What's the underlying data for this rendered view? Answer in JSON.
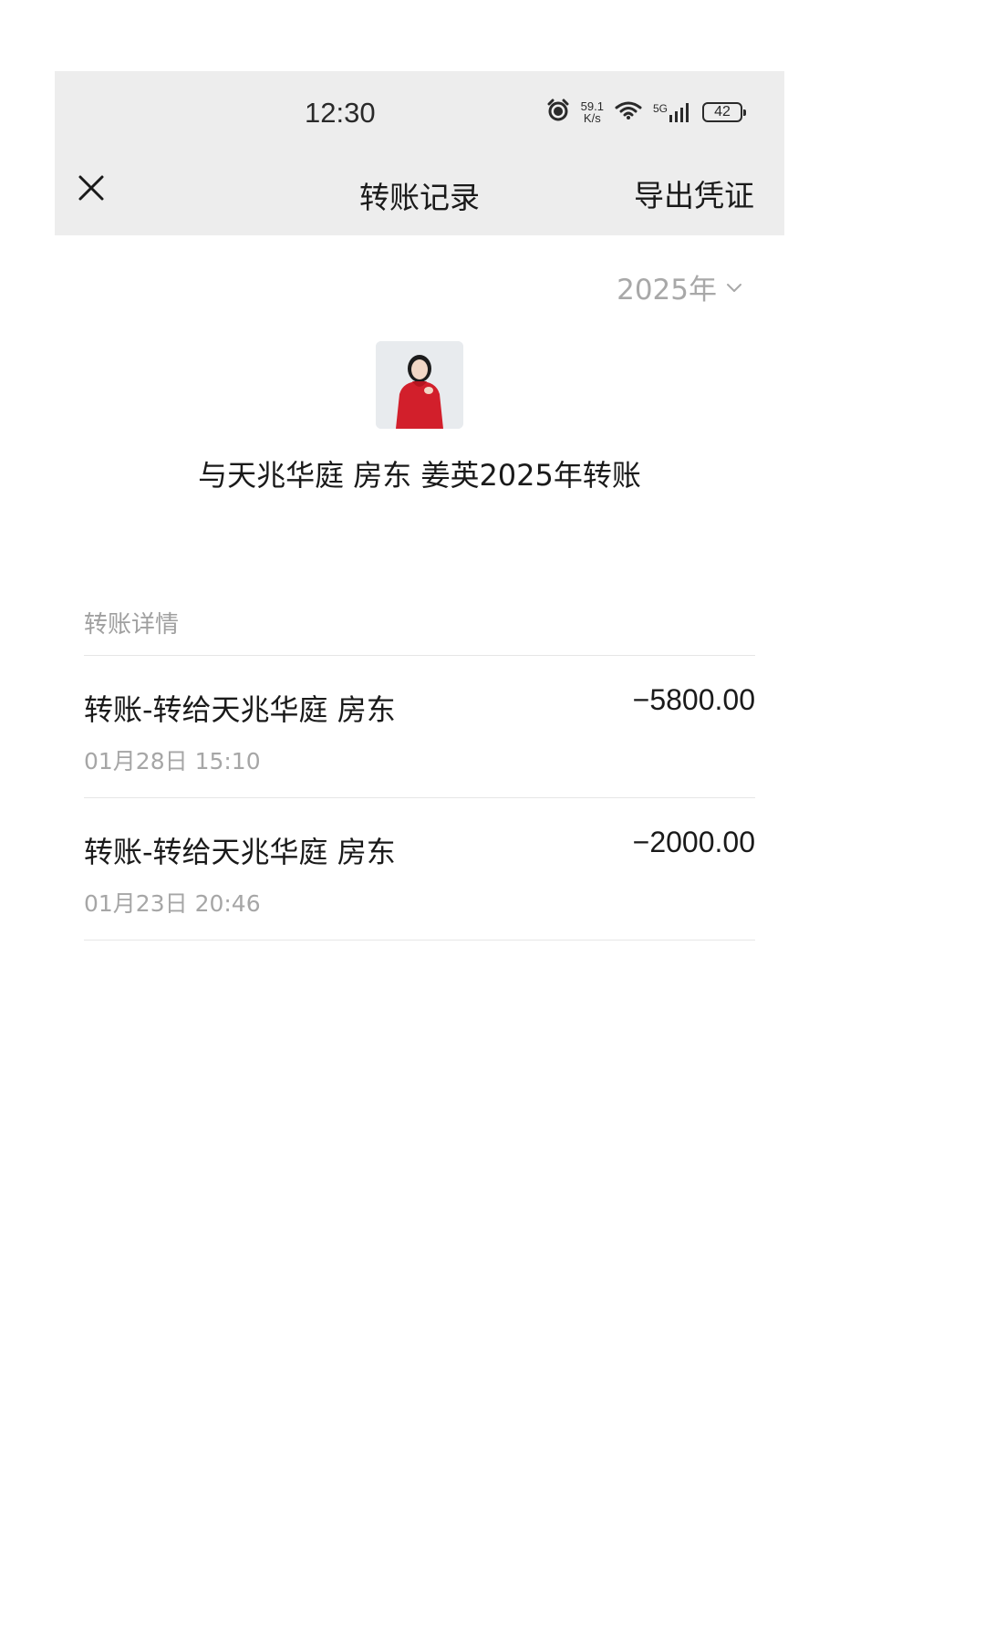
{
  "status_bar": {
    "time": "12:30",
    "net_speed_value": "59.1",
    "net_speed_unit": "K/s",
    "network_type": "5G",
    "battery": "42",
    "icons": [
      "alarm-icon",
      "wifi-icon",
      "signal-icon",
      "battery-icon"
    ]
  },
  "nav": {
    "close_icon": "close-icon",
    "title": "转账记录",
    "export_label": "导出凭证"
  },
  "filter": {
    "year_label": "2025年",
    "chevron_icon": "chevron-down-icon"
  },
  "contact": {
    "avatar_desc": "avatar",
    "summary_title": "与天兆华庭 房东 姜英2025年转账"
  },
  "details": {
    "section_label": "转账详情",
    "transactions": [
      {
        "title": "转账-转给天兆华庭 房东",
        "time": "01月28日 15:10",
        "amount": "−5800.00"
      },
      {
        "title": "转账-转给天兆华庭 房东",
        "time": "01月23日 20:46",
        "amount": "−2000.00"
      }
    ]
  },
  "colors": {
    "header_bg": "#ededed",
    "primary_text": "#1a1a1a",
    "secondary_text": "#a6a6a6",
    "avatar_accent": "#d21f2b"
  }
}
